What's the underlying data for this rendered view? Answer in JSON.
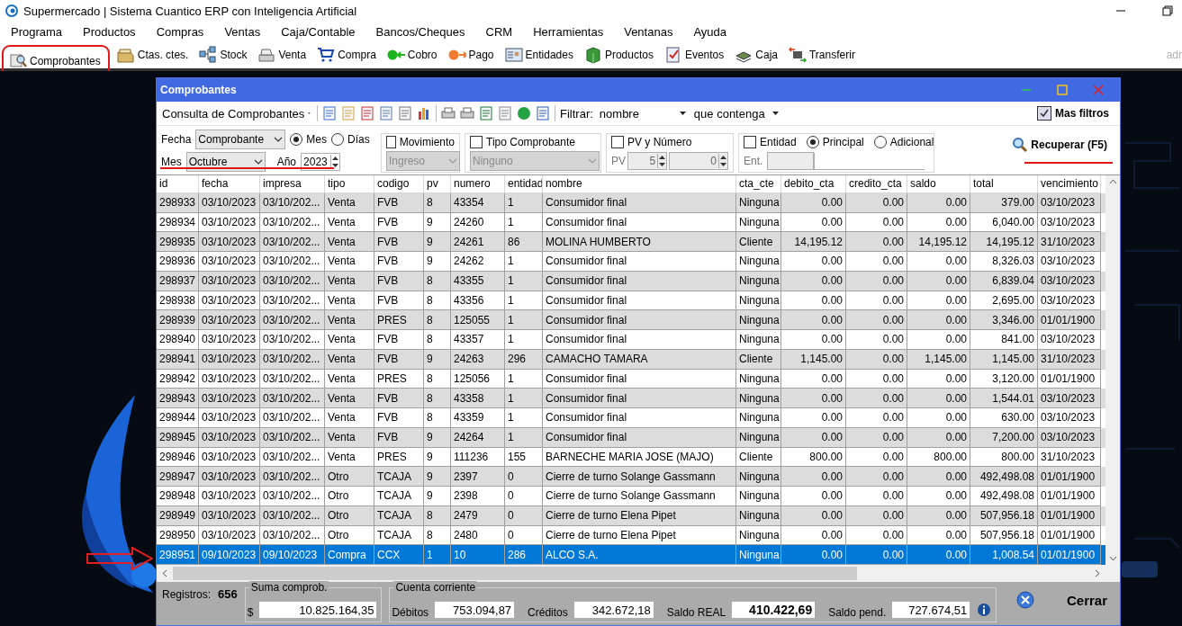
{
  "app": {
    "title": "Supermercado | Sistema Cuantico ERP con Inteligencia Artificial",
    "user": "adr",
    "menu": [
      "Programa",
      "Productos",
      "Compras",
      "Ventas",
      "Caja/Contable",
      "Bancos/Cheques",
      "CRM",
      "Herramientas",
      "Ventanas",
      "Ayuda"
    ],
    "toolbar": [
      {
        "label": "Comprobantes",
        "highlighted": true
      },
      {
        "label": "Ctas. ctes.",
        "highlighted": false
      },
      {
        "label": "Stock",
        "highlighted": false
      },
      {
        "label": "Venta",
        "highlighted": false
      },
      {
        "label": "Compra",
        "highlighted": false
      },
      {
        "label": "Cobro",
        "highlighted": false
      },
      {
        "label": "Pago",
        "highlighted": false
      },
      {
        "label": "Entidades",
        "highlighted": false
      },
      {
        "label": "Productos",
        "highlighted": false
      },
      {
        "label": "Eventos",
        "highlighted": false
      },
      {
        "label": "Caja",
        "highlighted": false
      },
      {
        "label": "Transferir",
        "highlighted": false
      }
    ]
  },
  "window": {
    "title": "Comprobantes",
    "toolbar": {
      "query": "Consulta de Comprobantes",
      "filter_label": "Filtrar:",
      "filter_field": "nombre",
      "filter_op": "que contenga",
      "more_filters": {
        "label": "Mas filtros",
        "checked": true
      }
    },
    "filters": {
      "fecha": {
        "label": "Fecha",
        "value": "Comprobante",
        "month_label": "Mes",
        "month": "Octubre",
        "year_label": "Año",
        "year": "2023",
        "modes": [
          {
            "label": "Mes",
            "selected": true
          },
          {
            "label": "Días",
            "selected": false
          }
        ]
      },
      "movimiento": {
        "label": "Movimiento",
        "checked": false,
        "value": "Ingreso"
      },
      "tipo": {
        "label": "Tipo Comprobante",
        "checked": false,
        "value": "Ninguno"
      },
      "pv": {
        "label": "PV y Número",
        "checked": false,
        "pv_label": "PV",
        "from": "5",
        "to": "0"
      },
      "entidad": {
        "label": "Entidad",
        "checked": false,
        "modes": [
          {
            "label": "Principal",
            "selected": true
          },
          {
            "label": "Adicional",
            "selected": false
          }
        ],
        "ent_label": "Ent."
      },
      "recuperar": "Recuperar (F5)"
    },
    "table": {
      "columns": [
        "id",
        "fecha",
        "impresa",
        "tipo",
        "codigo",
        "pv",
        "numero",
        "entidad",
        "nombre",
        "cta_cte",
        "debito_cta",
        "credito_cta",
        "saldo",
        "total",
        "vencimiento"
      ],
      "rows": [
        {
          "selected": false,
          "cells": [
            "298933",
            "03/10/2023",
            "03/10/202...",
            "Venta",
            "FVB",
            "8",
            "43354",
            "1",
            "Consumidor final",
            "Ninguna",
            "0.00",
            "0.00",
            "0.00",
            "379.00",
            "03/10/2023"
          ]
        },
        {
          "selected": false,
          "cells": [
            "298934",
            "03/10/2023",
            "03/10/202...",
            "Venta",
            "FVB",
            "9",
            "24260",
            "1",
            "Consumidor final",
            "Ninguna",
            "0.00",
            "0.00",
            "0.00",
            "6,040.00",
            "03/10/2023"
          ]
        },
        {
          "selected": false,
          "cells": [
            "298935",
            "03/10/2023",
            "03/10/202...",
            "Venta",
            "FVB",
            "9",
            "24261",
            "86",
            "MOLINA HUMBERTO",
            "Cliente",
            "14,195.12",
            "0.00",
            "14,195.12",
            "14,195.12",
            "31/10/2023"
          ]
        },
        {
          "selected": false,
          "cells": [
            "298936",
            "03/10/2023",
            "03/10/202...",
            "Venta",
            "FVB",
            "9",
            "24262",
            "1",
            "Consumidor final",
            "Ninguna",
            "0.00",
            "0.00",
            "0.00",
            "8,326.03",
            "03/10/2023"
          ]
        },
        {
          "selected": false,
          "cells": [
            "298937",
            "03/10/2023",
            "03/10/202...",
            "Venta",
            "FVB",
            "8",
            "43355",
            "1",
            "Consumidor final",
            "Ninguna",
            "0.00",
            "0.00",
            "0.00",
            "6,839.04",
            "03/10/2023"
          ]
        },
        {
          "selected": false,
          "cells": [
            "298938",
            "03/10/2023",
            "03/10/202...",
            "Venta",
            "FVB",
            "8",
            "43356",
            "1",
            "Consumidor final",
            "Ninguna",
            "0.00",
            "0.00",
            "0.00",
            "2,695.00",
            "03/10/2023"
          ]
        },
        {
          "selected": false,
          "cells": [
            "298939",
            "03/10/2023",
            "03/10/202...",
            "Venta",
            "PRES",
            "8",
            "125055",
            "1",
            "Consumidor final",
            "Ninguna",
            "0.00",
            "0.00",
            "0.00",
            "3,346.00",
            "01/01/1900"
          ]
        },
        {
          "selected": false,
          "cells": [
            "298940",
            "03/10/2023",
            "03/10/202...",
            "Venta",
            "FVB",
            "8",
            "43357",
            "1",
            "Consumidor final",
            "Ninguna",
            "0.00",
            "0.00",
            "0.00",
            "841.00",
            "03/10/2023"
          ]
        },
        {
          "selected": false,
          "cells": [
            "298941",
            "03/10/2023",
            "03/10/202...",
            "Venta",
            "FVB",
            "9",
            "24263",
            "296",
            "CAMACHO TAMARA",
            "Cliente",
            "1,145.00",
            "0.00",
            "1,145.00",
            "1,145.00",
            "31/10/2023"
          ]
        },
        {
          "selected": false,
          "cells": [
            "298942",
            "03/10/2023",
            "03/10/202...",
            "Venta",
            "PRES",
            "8",
            "125056",
            "1",
            "Consumidor final",
            "Ninguna",
            "0.00",
            "0.00",
            "0.00",
            "3,120.00",
            "01/01/1900"
          ]
        },
        {
          "selected": false,
          "cells": [
            "298943",
            "03/10/2023",
            "03/10/202...",
            "Venta",
            "FVB",
            "8",
            "43358",
            "1",
            "Consumidor final",
            "Ninguna",
            "0.00",
            "0.00",
            "0.00",
            "1,544.01",
            "03/10/2023"
          ]
        },
        {
          "selected": false,
          "cells": [
            "298944",
            "03/10/2023",
            "03/10/202...",
            "Venta",
            "FVB",
            "8",
            "43359",
            "1",
            "Consumidor final",
            "Ninguna",
            "0.00",
            "0.00",
            "0.00",
            "630.00",
            "03/10/2023"
          ]
        },
        {
          "selected": false,
          "cells": [
            "298945",
            "03/10/2023",
            "03/10/202...",
            "Venta",
            "FVB",
            "9",
            "24264",
            "1",
            "Consumidor final",
            "Ninguna",
            "0.00",
            "0.00",
            "0.00",
            "7,200.00",
            "03/10/2023"
          ]
        },
        {
          "selected": false,
          "cells": [
            "298946",
            "03/10/2023",
            "03/10/202...",
            "Venta",
            "PRES",
            "9",
            "111236",
            "155",
            "BARNECHE MARIA JOSE (MAJO)",
            "Cliente",
            "800.00",
            "0.00",
            "800.00",
            "800.00",
            "31/10/2023"
          ]
        },
        {
          "selected": false,
          "cells": [
            "298947",
            "03/10/2023",
            "03/10/202...",
            "Otro",
            "TCAJA",
            "9",
            "2397",
            "0",
            "Cierre de turno Solange Gassmann",
            "Ninguna",
            "0.00",
            "0.00",
            "0.00",
            "492,498.08",
            "01/01/1900"
          ]
        },
        {
          "selected": false,
          "cells": [
            "298948",
            "03/10/2023",
            "03/10/202...",
            "Otro",
            "TCAJA",
            "9",
            "2398",
            "0",
            "Cierre de turno Solange Gassmann",
            "Ninguna",
            "0.00",
            "0.00",
            "0.00",
            "492,498.08",
            "01/01/1900"
          ]
        },
        {
          "selected": false,
          "cells": [
            "298949",
            "03/10/2023",
            "03/10/202...",
            "Otro",
            "TCAJA",
            "8",
            "2479",
            "0",
            "Cierre de turno Elena Pipet",
            "Ninguna",
            "0.00",
            "0.00",
            "0.00",
            "507,956.18",
            "01/01/1900"
          ]
        },
        {
          "selected": false,
          "cells": [
            "298950",
            "03/10/2023",
            "03/10/202...",
            "Otro",
            "TCAJA",
            "8",
            "2480",
            "0",
            "Cierre de turno Elena Pipet",
            "Ninguna",
            "0.00",
            "0.00",
            "0.00",
            "507,956.18",
            "01/01/1900"
          ]
        },
        {
          "selected": true,
          "cells": [
            "298951",
            "09/10/2023",
            "09/10/2023",
            "Compra",
            "CCX",
            "1",
            "10",
            "286",
            "ALCO S.A.",
            "Ninguna",
            "0.00",
            "0.00",
            "0.00",
            "1,008.54",
            "01/01/1900"
          ]
        }
      ]
    },
    "footer": {
      "records_label": "Registros:",
      "records": "656",
      "sum_label": "Suma comprob.",
      "currency": "$",
      "sum": "10.825.164,35",
      "account_label": "Cuenta corriente",
      "debits_label": "Débitos",
      "debits": "753.094,87",
      "credits_label": "Créditos",
      "credits": "342.672,18",
      "balance_label": "Saldo REAL",
      "balance": "410.422,69",
      "pending_label": "Saldo pend.",
      "pending": "727.674,51",
      "close": "Cerrar"
    }
  }
}
